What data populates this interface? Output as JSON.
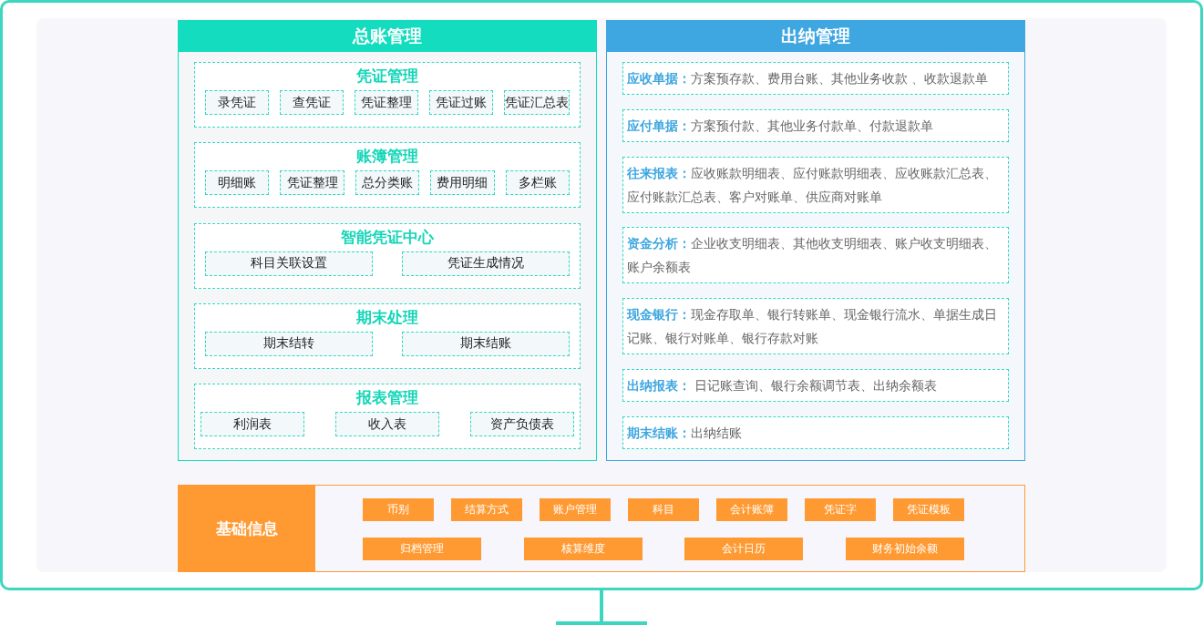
{
  "general_ledger": {
    "title": "总账管理",
    "sections": [
      {
        "title": "凭证管理",
        "items": [
          "录凭证",
          "查凭证",
          "凭证整理",
          "凭证过账",
          "凭证汇总表"
        ]
      },
      {
        "title": "账簿管理",
        "items": [
          "明细账",
          "凭证整理",
          "总分类账",
          "费用明细",
          "多栏账"
        ]
      },
      {
        "title": "智能凭证中心",
        "items": [
          "科目关联设置",
          "凭证生成情况"
        ]
      },
      {
        "title": "期末处理",
        "items": [
          "期末结转",
          "期末结账"
        ]
      },
      {
        "title": "报表管理",
        "items": [
          "利润表",
          "收入表",
          "资产负债表"
        ]
      }
    ]
  },
  "cashier": {
    "title": "出纳管理",
    "entries": [
      "**应收单据：**方案预存款、费用台账、其他业务收款 、收款退款单",
      "**应付单据：**方案预付款、其他业务付款单、付款退款单",
      "**往来报表：**应收账款明细表、应付账款明细表、应收账款汇总表、应付账款汇总表、客户对账单、供应商对账单",
      "**资金分析：**企业收支明细表、其他收支明细表、账户收支明细表、账户余额表",
      "**现金银行：**现金存取单、银行转账单、现金银行流水、单据生成日记账、银行对账单、银行存款对账",
      "**出纳报表：** 日记账查询、银行余额调节表、出纳余额表",
      "**期末结账：**出纳结账"
    ]
  },
  "basic_info": {
    "title": "基础信息",
    "rows": [
      {
        "items": [
          "币别",
          "结算方式",
          "账户管理",
          "科目",
          "会计账簿",
          "凭证字",
          "凭证模板"
        ]
      },
      {
        "items": [
          "归档管理",
          "核算维度",
          "会计日历",
          "财务初始余额"
        ]
      }
    ]
  }
}
